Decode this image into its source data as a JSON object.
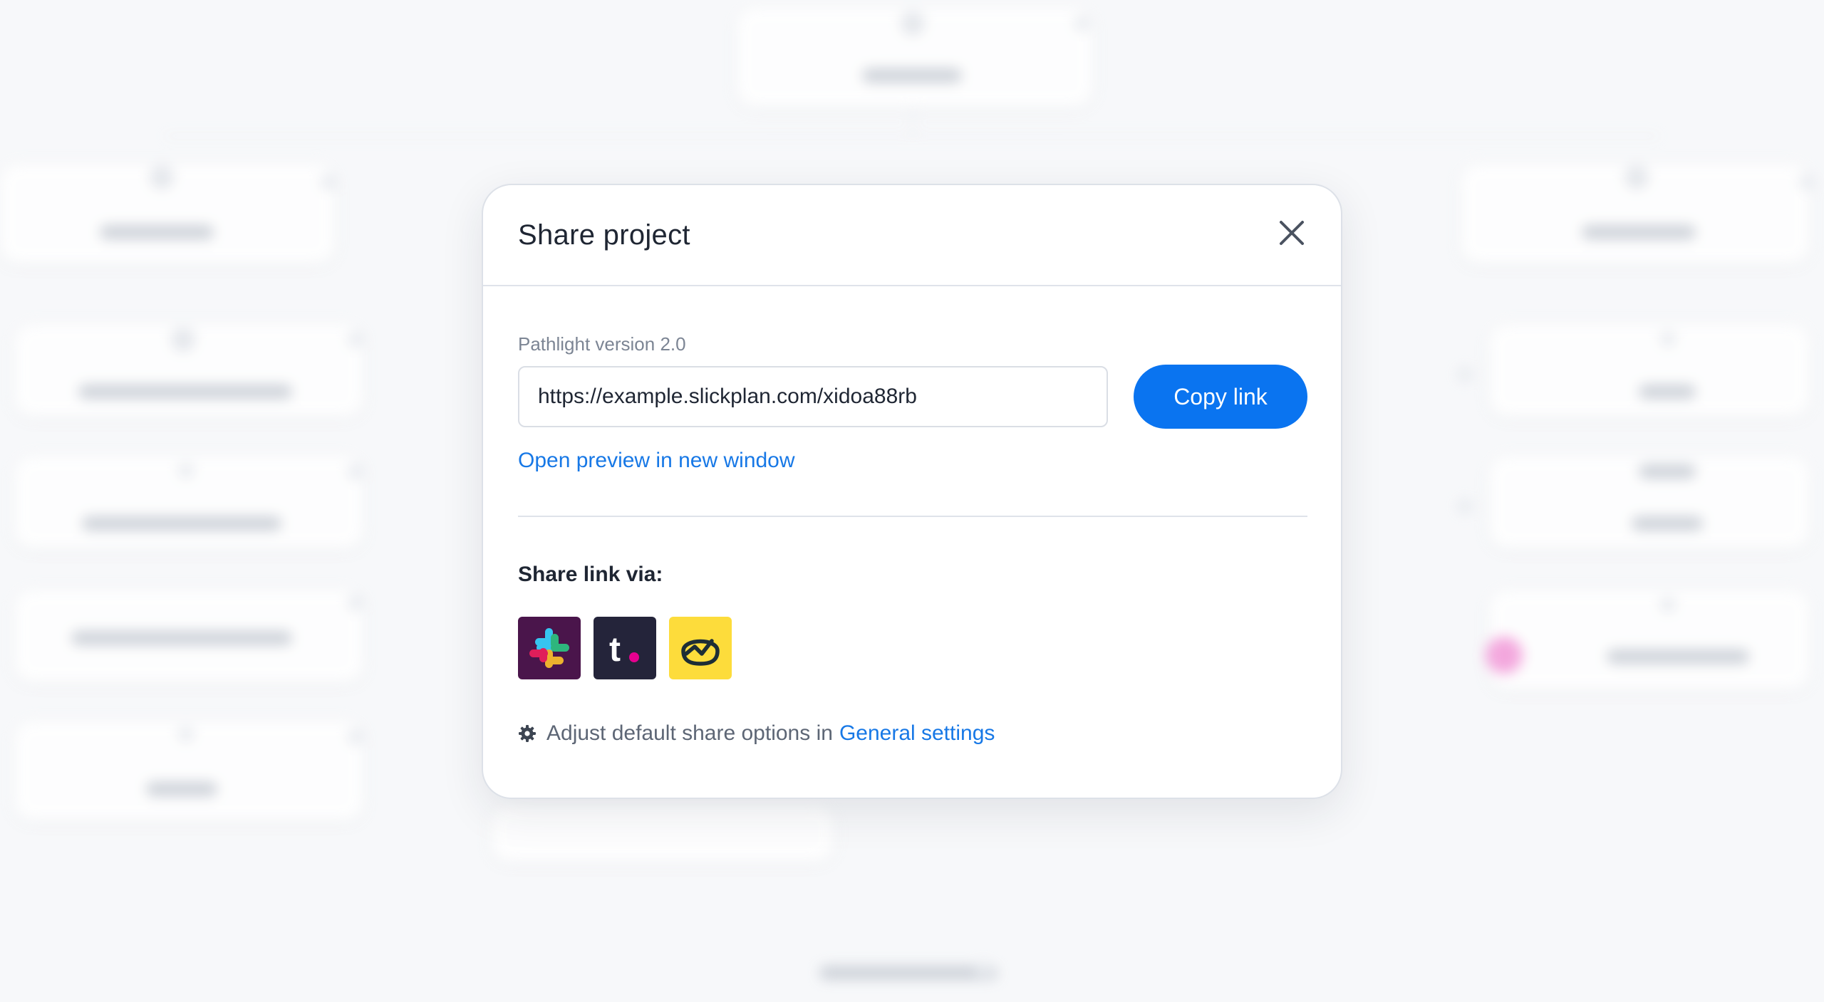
{
  "modal": {
    "title": "Share project",
    "close_icon": "close-icon",
    "version_label": "Pathlight version 2.0",
    "share_url": "https://example.slickplan.com/xidoa88rb",
    "copy_button_label": "Copy link",
    "preview_link_label": "Open preview in new window",
    "share_via_label": "Share link via:",
    "integrations": [
      {
        "name": "Slack",
        "icon": "slack-icon"
      },
      {
        "name": "Toggl",
        "icon": "toggl-icon"
      },
      {
        "name": "Basecamp",
        "icon": "basecamp-icon"
      }
    ],
    "settings_hint": "Adjust default share options in",
    "settings_link_label": "General settings",
    "settings_icon": "gear-icon"
  },
  "colors": {
    "primary": "#0a74f0",
    "link": "#1778e6",
    "slack_bg": "#4a154b",
    "toggl_bg": "#24243a",
    "basecamp_bg": "#fddc3b"
  }
}
